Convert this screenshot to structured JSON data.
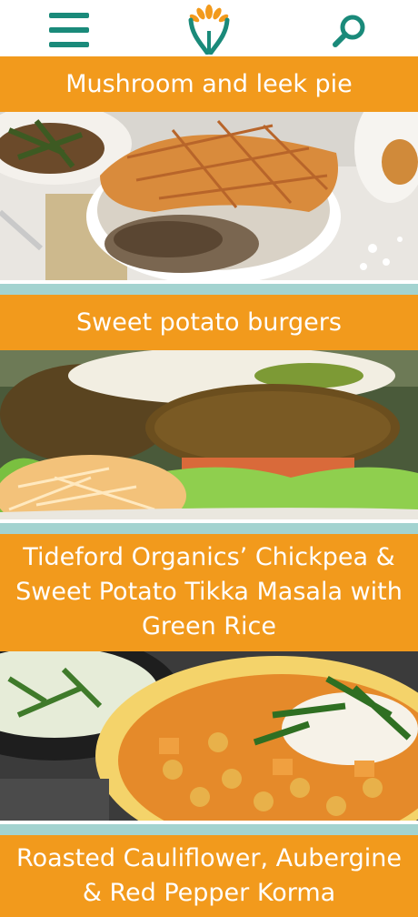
{
  "header": {
    "menu_icon": "hamburger-menu-icon",
    "logo_icon": "plant-sprout-logo-icon",
    "search_icon": "search-icon",
    "accent_color": "#1a8a7a",
    "logo_petal_color": "#f29a1c"
  },
  "recipes": [
    {
      "title": "Mushroom and leek pie",
      "image": "mushroom-leek-pie-photo"
    },
    {
      "title": "Sweet potato burgers",
      "image": "sweet-potato-burger-photo"
    },
    {
      "title": "Tideford Organics’ Chickpea & Sweet Potato Tikka Masala with Green Rice",
      "image": "chickpea-tikka-masala-photo"
    },
    {
      "title": "Roasted Cauliflower, Aubergine & Red Pepper Korma",
      "image": ""
    }
  ],
  "colors": {
    "title_bar": "#f29a1c",
    "separator": "#a3d3d0",
    "title_text": "#ffffff"
  }
}
